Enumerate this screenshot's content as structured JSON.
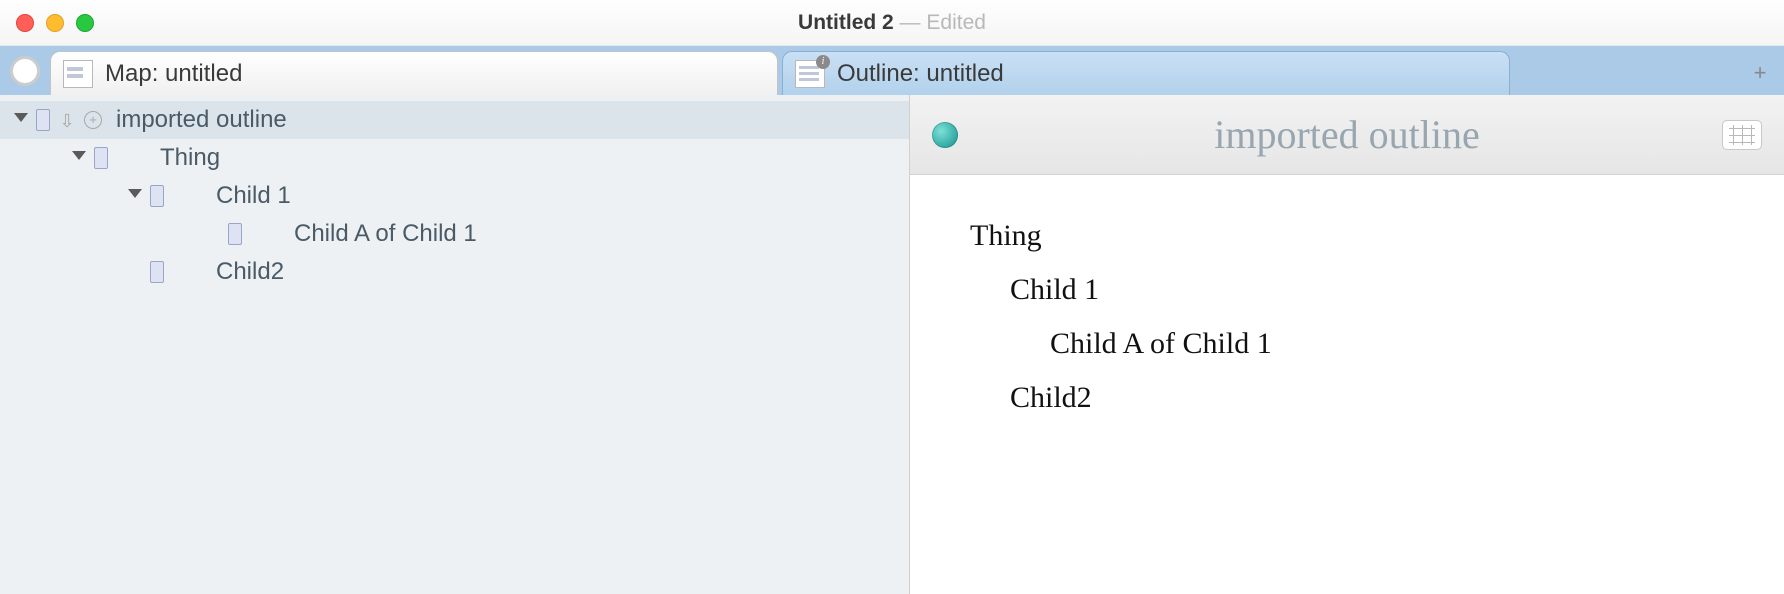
{
  "window": {
    "title": "Untitled 2",
    "edited_label": " — Edited"
  },
  "tabs": {
    "left": {
      "label": "Map: untitled"
    },
    "right": {
      "label": "Outline: untitled",
      "info_badge": "i"
    },
    "add_label": "+"
  },
  "outline_tree": [
    {
      "label": "imported outline",
      "level": 0,
      "expanded": true,
      "selected": true,
      "has_arrow": true,
      "has_plus": true
    },
    {
      "label": "Thing",
      "level": 1,
      "expanded": true
    },
    {
      "label": "Child 1",
      "level": 2,
      "expanded": true
    },
    {
      "label": "Child A of Child 1",
      "level": 3,
      "expanded": false
    },
    {
      "label": "Child2",
      "level": 2,
      "expanded": false,
      "alt_indent": true
    }
  ],
  "detail": {
    "title": "imported outline",
    "items": [
      {
        "label": "Thing",
        "level": 0
      },
      {
        "label": "Child 1",
        "level": 1
      },
      {
        "label": "Child A of Child 1",
        "level": 2
      },
      {
        "label": "Child2",
        "level": 1
      }
    ]
  }
}
